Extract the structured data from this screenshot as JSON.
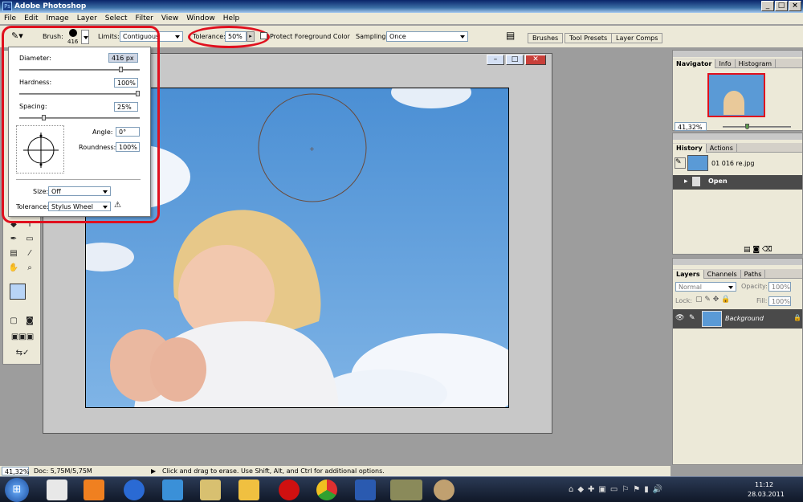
{
  "app": {
    "title": "Adobe Photoshop"
  },
  "menu": [
    "File",
    "Edit",
    "Image",
    "Layer",
    "Select",
    "Filter",
    "View",
    "Window",
    "Help"
  ],
  "options": {
    "brush_label": "Brush:",
    "brush_size": "416",
    "limits_label": "Limits:",
    "limits_value": "Contiguous",
    "tolerance_label": "Tolerance:",
    "tolerance_value": "50%",
    "protect_label": "Protect Foreground Color",
    "sampling_label": "Sampling:",
    "sampling_value": "Once",
    "tabs": [
      "Brushes",
      "Tool Presets",
      "Layer Comps"
    ]
  },
  "brush_popup": {
    "diameter_label": "Diameter:",
    "diameter_value": "416 px",
    "hardness_label": "Hardness:",
    "hardness_value": "100%",
    "spacing_label": "Spacing:",
    "spacing_value": "25%",
    "angle_label": "Angle:",
    "angle_value": "0°",
    "roundness_label": "Roundness:",
    "roundness_value": "100%",
    "size_label": "Size:",
    "size_value": "Off",
    "tolerance_label": "Tolerance:",
    "tolerance_value": "Stylus Wheel"
  },
  "navigator": {
    "tabs": [
      "Navigator",
      "Info",
      "Histogram"
    ],
    "zoom": "41,32%"
  },
  "history": {
    "tabs": [
      "History",
      "Actions"
    ],
    "snapshot": "01 016 re.jpg",
    "step": "Open"
  },
  "layers": {
    "tabs": [
      "Layers",
      "Channels",
      "Paths"
    ],
    "blend": "Normal",
    "opacity_label": "Opacity:",
    "opacity": "100%",
    "lock_label": "Lock:",
    "fill_label": "Fill:",
    "fill": "100%",
    "layer_name": "Background"
  },
  "status": {
    "zoom": "41,32%",
    "doc": "Doc: 5,75M/5,75M",
    "hint": "Click and drag to erase.  Use Shift, Alt, and Ctrl for additional options."
  },
  "taskbar": {
    "time": "11:12",
    "date": "28.03.2011"
  },
  "colors": {
    "highlight": "#e0101e",
    "sky": "#5a9ad6",
    "selected_row": "#4a4a4a"
  }
}
